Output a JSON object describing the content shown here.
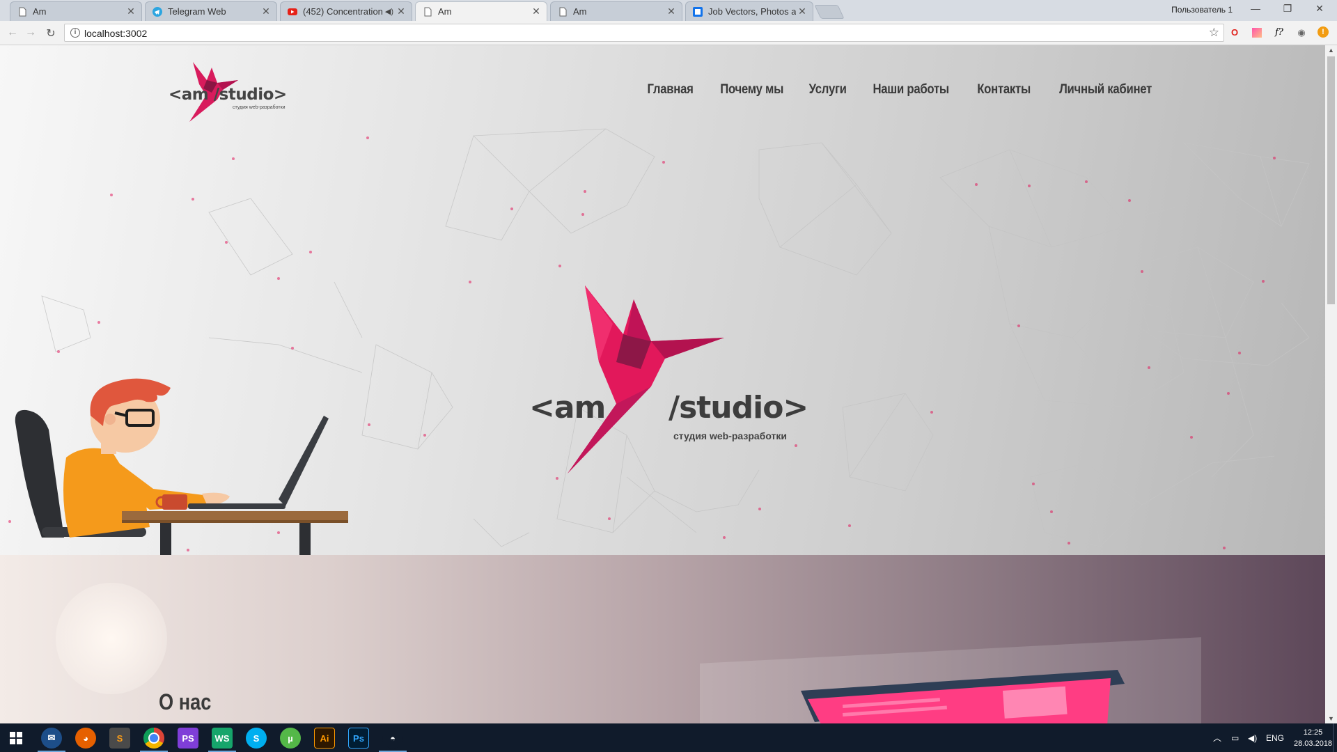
{
  "browser": {
    "tabs": [
      {
        "title": "Am",
        "icon": "page-icon",
        "active": false
      },
      {
        "title": "Telegram Web",
        "icon": "telegram-icon",
        "active": false
      },
      {
        "title": "(452) Concentration \\",
        "icon": "youtube-icon",
        "active": false,
        "audio": true
      },
      {
        "title": "Am",
        "icon": "page-icon",
        "active": true
      },
      {
        "title": "Am",
        "icon": "page-icon",
        "active": false
      },
      {
        "title": "Job Vectors, Photos and",
        "icon": "freepik-icon",
        "active": false
      }
    ],
    "user_label": "Пользователь 1",
    "url": "localhost:3002"
  },
  "site": {
    "logo": {
      "small_text": "<am /studio>",
      "tagline": "студия web-разработки"
    },
    "nav": [
      "Главная",
      "Почему мы",
      "Услуги",
      "Наши работы",
      "Контакты",
      "Личный кабинет"
    ],
    "hero_logo": {
      "left": "<am",
      "right": "/studio>",
      "tagline": "студия web-разработки"
    },
    "about_title": "О нас"
  },
  "taskbar": {
    "apps": [
      "windows-start-icon",
      "thunderbird-icon",
      "firefox-icon",
      "sublime-icon",
      "chrome-icon",
      "phpstorm-icon",
      "webstorm-icon",
      "skype-icon",
      "utorrent-icon",
      "illustrator-icon",
      "photoshop-icon",
      "inkscape-icon"
    ],
    "app_labels": {
      "phpstorm": "PS",
      "webstorm": "WS",
      "illustrator": "Ai",
      "photoshop": "Ps"
    },
    "language": "ENG",
    "time": "12:25",
    "date": "28.03.2018"
  },
  "colors": {
    "brand_pink": "#e2185b",
    "brand_dark": "#7b1a4a",
    "text_dark": "#3a3a3a"
  }
}
